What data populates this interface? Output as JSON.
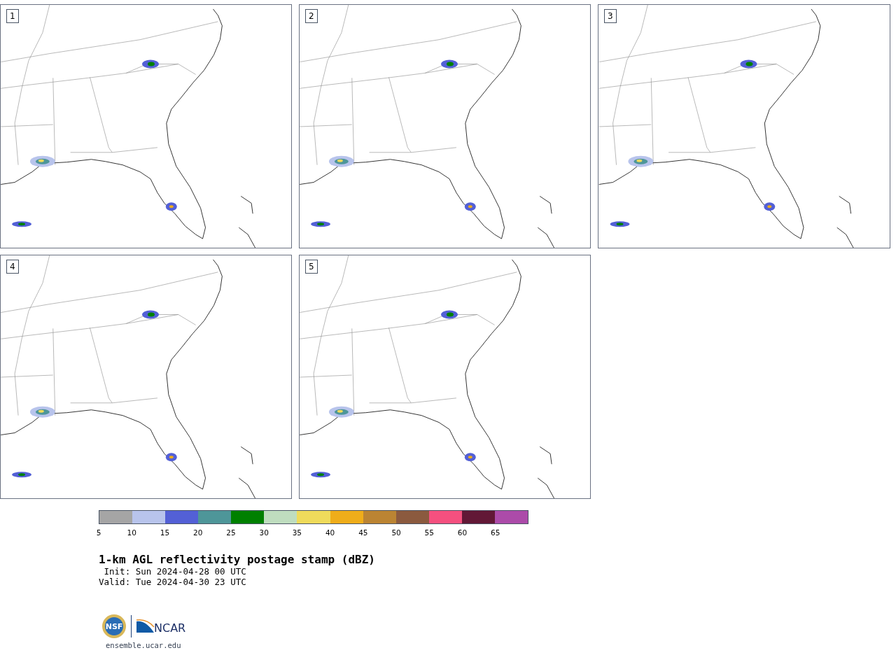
{
  "panels": [
    {
      "label": "1"
    },
    {
      "label": "2"
    },
    {
      "label": "3"
    },
    {
      "label": "4"
    },
    {
      "label": "5"
    }
  ],
  "colorbar": {
    "segments": [
      {
        "color": "#a5a5a5"
      },
      {
        "color": "#b8c4ec"
      },
      {
        "color": "#5360d6"
      },
      {
        "color": "#4e9699"
      },
      {
        "color": "#008000"
      },
      {
        "color": "#bfddbf"
      },
      {
        "color": "#efdb5b"
      },
      {
        "color": "#efad1a"
      },
      {
        "color": "#bb8433"
      },
      {
        "color": "#8b5a3f"
      },
      {
        "color": "#f5507f"
      },
      {
        "color": "#621836"
      },
      {
        "color": "#ac4ba9"
      }
    ],
    "ticks": [
      "5",
      "10",
      "15",
      "20",
      "25",
      "30",
      "35",
      "40",
      "45",
      "50",
      "55",
      "60",
      "65"
    ]
  },
  "title": "1-km AGL reflectivity postage stamp (dBZ)",
  "init": " Init: Sun 2024-04-28 00 UTC",
  "valid": "Valid: Tue 2024-04-30 23 UTC",
  "logo": {
    "left": "NSF",
    "right": "NCAR"
  },
  "url": "ensemble.ucar.edu"
}
